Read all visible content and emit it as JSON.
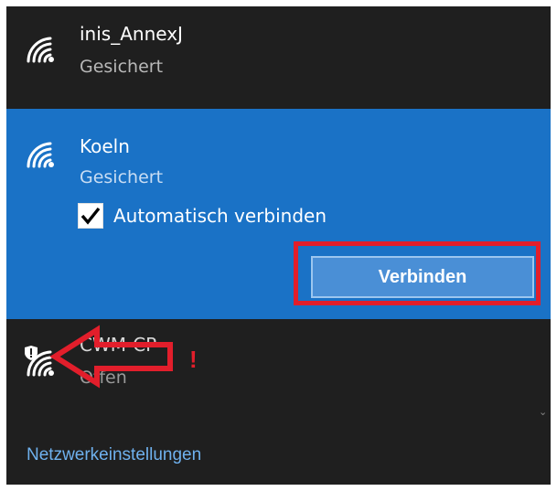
{
  "networks": [
    {
      "name": "inis_AnnexJ",
      "status": "Gesichert",
      "icon": "wifi-icon"
    },
    {
      "name": "Koeln",
      "status": "Gesichert",
      "icon": "wifi-icon",
      "auto_connect_label": "Automatisch verbinden",
      "auto_connect_checked": true,
      "connect_label": "Verbinden"
    },
    {
      "name": "CWM-CP",
      "status": "Offen",
      "icon": "wifi-shield-icon"
    }
  ],
  "annotation": {
    "mark": "!"
  },
  "footer": {
    "settings_label": "Netzwerkeinstellungen"
  },
  "colors": {
    "panel_bg": "#1f1f1f",
    "selected_bg": "#1a72c6",
    "button_bg": "#4a8fd6",
    "annotation_red": "#e21e2b",
    "link": "#6fb1ee"
  }
}
